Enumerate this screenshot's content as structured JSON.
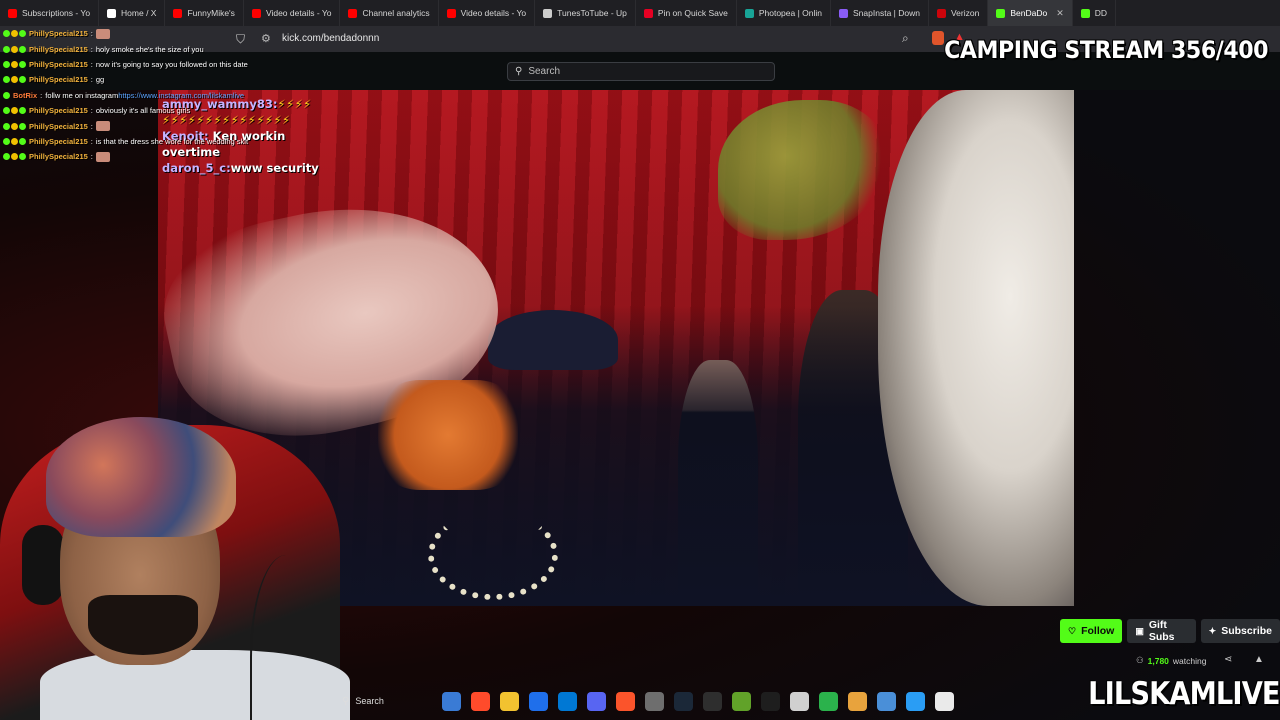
{
  "browser": {
    "tabs": [
      {
        "label": "Subscriptions - Yo",
        "favicon_color": "#ff0000"
      },
      {
        "label": "Home / X",
        "favicon_color": "#ffffff"
      },
      {
        "label": "FunnyMike's",
        "favicon_color": "#ff0000"
      },
      {
        "label": "Video details - Yo",
        "favicon_color": "#ff0000"
      },
      {
        "label": "Channel analytics",
        "favicon_color": "#ff0000"
      },
      {
        "label": "Video details - Yo",
        "favicon_color": "#ff0000"
      },
      {
        "label": "TunesToTube - Up",
        "favicon_color": "#cccccc"
      },
      {
        "label": "Pin on Quick Save",
        "favicon_color": "#e60023"
      },
      {
        "label": "Photopea | Onlin",
        "favicon_color": "#18a497"
      },
      {
        "label": "SnapInsta | Down",
        "favicon_color": "#8a5cf6"
      },
      {
        "label": "Verizon",
        "favicon_color": "#cd040b"
      },
      {
        "label": "BenDaDo",
        "favicon_color": "#53fc18",
        "active": true
      },
      {
        "label": "DD",
        "favicon_color": "#53fc18"
      }
    ],
    "url": "kick.com/bendadonnn",
    "close_glyph": "✕"
  },
  "kick": {
    "search_placeholder": "Search",
    "follow_label": "Follow",
    "gift_subs_label": "Gift Subs",
    "subscribe_label": "Subscribe",
    "viewer_count": "1,780",
    "watching_label": "watching",
    "accent_color": "#53fc18"
  },
  "overlay": {
    "camping_stream": "CAMPING STREAM 356/400",
    "channel_name": "LILSKAMLIVE"
  },
  "video_chat": {
    "line1_user": "ammy_wammy83:",
    "line1_bolts": "⚡⚡⚡⚡",
    "line2_bolts": "⚡⚡⚡⚡⚡⚡⚡⚡⚡⚡⚡⚡⚡⚡⚡",
    "line3_user": "Kenoit:",
    "line3_text": " Ken workin",
    "line4_text": "overtime",
    "line5_user": "daron_5_c:",
    "line5_text": "www security"
  },
  "stream_chat": [
    {
      "user": "PhillySpecial215",
      "text": "",
      "emote": true
    },
    {
      "user": "PhillySpecial215",
      "text": "holy smoke she's the size of you",
      "emote": false
    },
    {
      "user": "PhillySpecial215",
      "text": "now it's going to say you followed on this date",
      "emote": false
    },
    {
      "user": "PhillySpecial215",
      "text": "gg",
      "emote": false
    },
    {
      "user": "BotRix",
      "text": "follw me on instagram ",
      "link": "https://www.instagram.com/lilskamlive",
      "bot": true
    },
    {
      "user": "PhillySpecial215",
      "text": "obviously it's all famous girls",
      "emote": false
    },
    {
      "user": "PhillySpecial215",
      "text": "",
      "emote": true
    },
    {
      "user": "PhillySpecial215",
      "text": "is that the dress she wore for the wedding skit",
      "emote": false
    },
    {
      "user": "PhillySpecial215",
      "text": "",
      "emote": true
    }
  ],
  "taskbar": {
    "search_label": "Search",
    "apps": [
      "#3a7bd5",
      "#ff4b2b",
      "#f2c230",
      "#1f6feb",
      "#0078d4",
      "#5865f2",
      "#fb542b",
      "#6e6e6e",
      "#1b2838",
      "#2e2e2e",
      "#61a229",
      "#1e1e1e",
      "#d0d0d0",
      "#2bb24c",
      "#e8a33d",
      "#4a8fd8",
      "#2a9df4",
      "#eaeaea"
    ]
  }
}
